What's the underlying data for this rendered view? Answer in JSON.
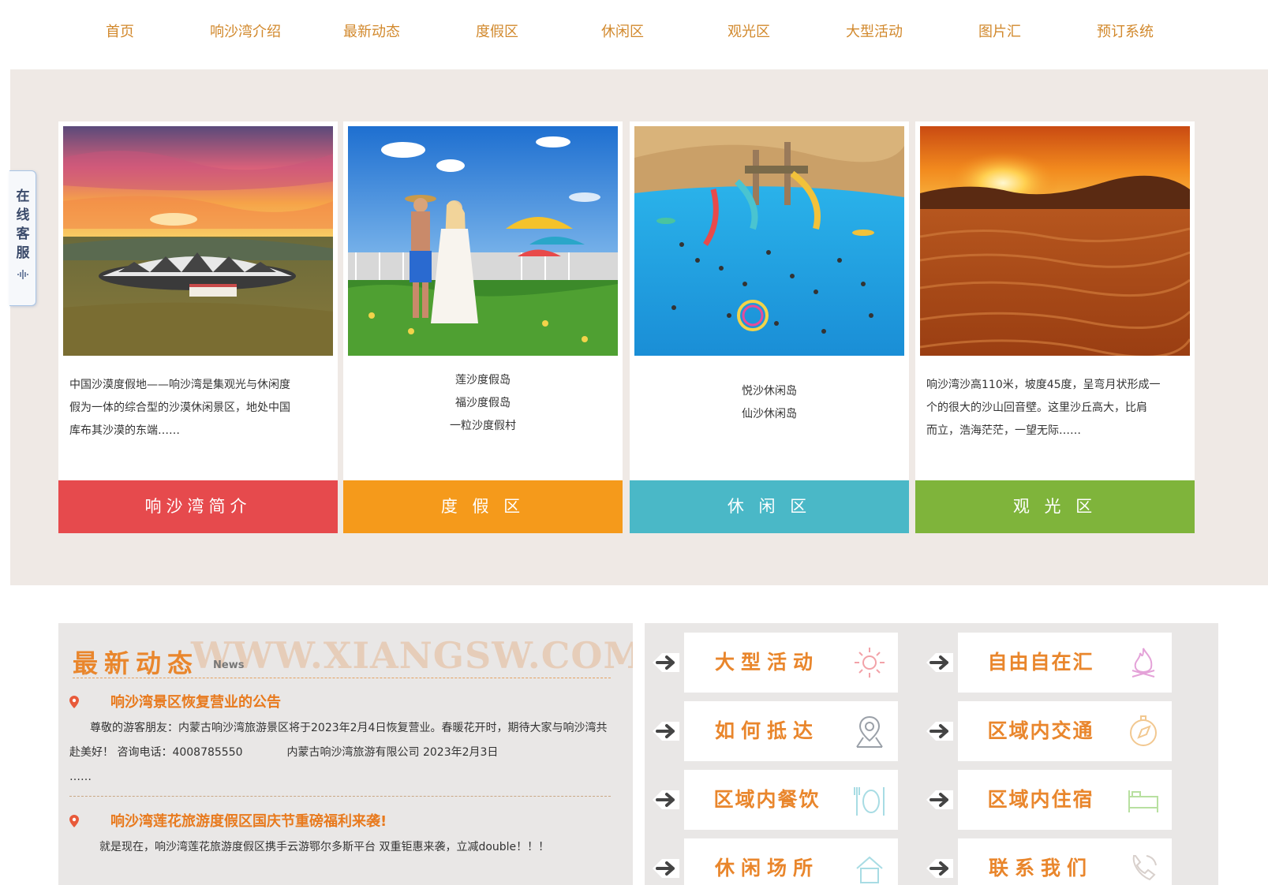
{
  "nav": {
    "items": [
      "首页",
      "响沙湾介绍",
      "最新动态",
      "度假区",
      "休闲区",
      "观光区",
      "大型活动",
      "图片汇",
      "预订系统"
    ]
  },
  "side_tab": {
    "label": "在线客服"
  },
  "cards": [
    {
      "lines": [
        "中国沙漠度假地——响沙湾是集观光与休闲度",
        "假为一体的综合型的沙漠休闲景区，地处中国",
        "库布其沙漠的东端……"
      ],
      "button": "响沙湾简介",
      "color": "#e64a4d"
    },
    {
      "lines": [
        "莲沙度假岛",
        "福沙度假岛",
        "一粒沙度假村"
      ],
      "button": "度 假 区",
      "color": "#f59a1b"
    },
    {
      "lines": [
        "悦沙休闲岛",
        "仙沙休闲岛"
      ],
      "button": "休 闲 区",
      "color": "#4ab8c7"
    },
    {
      "lines": [
        "响沙湾沙高110米，坡度45度，呈弯月状形成一",
        "个的很大的沙山回音壁。这里沙丘高大，比肩",
        "而立，浩海茫茫，一望无际……"
      ],
      "button": "观 光 区",
      "color": "#7fb43b"
    }
  ],
  "news": {
    "title": "最新动态",
    "subtitle": "News",
    "watermark": "WWW.XIANGSW.COM",
    "items": [
      {
        "title": "响沙湾景区恢复营业的公告",
        "body": "尊敬的游客朋友：内蒙古响沙湾旅游景区将于2023年2月4日恢复营业。春暖花开时，期待大家与响沙湾共赴美好！ 咨询电话：4008785550　　　　内蒙古响沙湾旅游有限公司 2023年2月3日",
        "more": "……"
      },
      {
        "title": "响沙湾莲花旅游度假区国庆节重磅福利来袭!",
        "body": "就是现在，响沙湾莲花旅游度假区携手云游鄂尔多斯平台 双重钜惠来袭，立减double！！！"
      }
    ]
  },
  "quick_links": [
    {
      "label": "大型活动",
      "icon": "sun-icon"
    },
    {
      "label": "自由自在汇",
      "icon": "flame-icon"
    },
    {
      "label": "如何抵达",
      "icon": "map-pin-icon"
    },
    {
      "label": "区域内交通",
      "icon": "compass-icon"
    },
    {
      "label": "区域内餐饮",
      "icon": "utensils-icon"
    },
    {
      "label": "区域内住宿",
      "icon": "bed-icon"
    },
    {
      "label": "休闲场所",
      "icon": "house-icon"
    },
    {
      "label": "联系我们",
      "icon": "phone-icon"
    }
  ],
  "colors": {
    "nav_text": "#d2892d",
    "accent_orange": "#e9862c"
  }
}
